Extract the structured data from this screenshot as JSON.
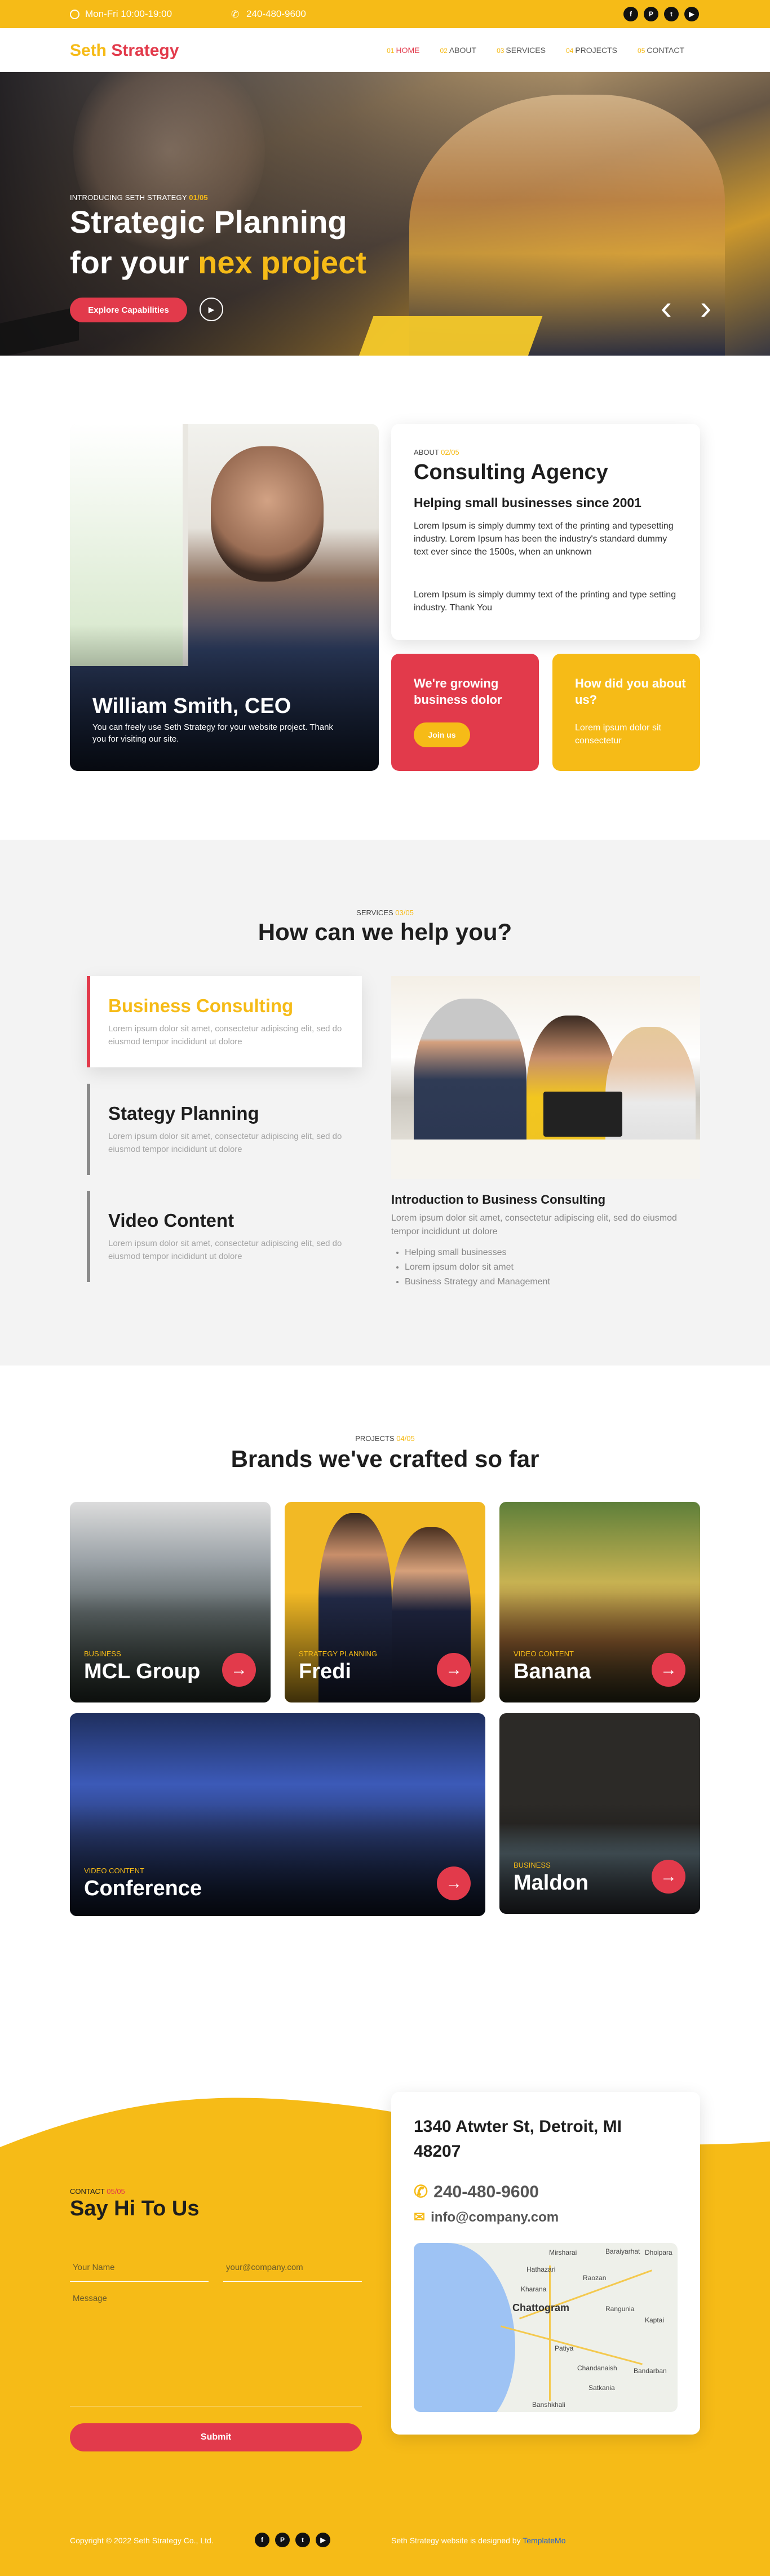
{
  "topbar": {
    "hours": "Mon-Fri 10:00-19:00",
    "phone": "240-480-9600",
    "social": [
      "facebook-icon",
      "pinterest-icon",
      "twitter-icon",
      "youtube-icon"
    ]
  },
  "nav": {
    "logo_a": "Seth",
    "logo_b": " Strategy",
    "items": [
      {
        "num": "01",
        "label": "HOME"
      },
      {
        "num": "02",
        "label": "ABOUT"
      },
      {
        "num": "03",
        "label": "SERVICES"
      },
      {
        "num": "04",
        "label": "PROJECTS"
      },
      {
        "num": "05",
        "label": "CONTACT"
      }
    ]
  },
  "hero": {
    "eyebrow": "INTRODUCING SETH STRATEGY ",
    "eyebrow_count": "01/05",
    "line1": "Strategic Planning",
    "line2_a": "for your ",
    "line2_b": "nex project",
    "cta": "Explore Capabilities",
    "play": "▶",
    "prev": "‹",
    "next": "›"
  },
  "about": {
    "ceo_name": "William Smith, CEO",
    "ceo_text": "You can freely use Seth Strategy for your website project. Thank you for visiting our site.",
    "eyebrow": "ABOUT ",
    "eyebrow_count": "02/05",
    "title": "Consulting Agency",
    "subtitle": "Helping small businesses since 2001",
    "para1": "Lorem Ipsum is simply dummy text of the printing and typesetting industry. Lorem Ipsum has been the industry's standard dummy text ever since the 1500s, when an unknown",
    "para2": "Lorem Ipsum is simply dummy text of the printing and type setting industry. Thank You",
    "card_red_title": "We're growing business dolor",
    "card_red_button": "Join us",
    "card_yellow_title": "How did you about us?",
    "card_yellow_text": "Lorem ipsum dolor sit consectetur"
  },
  "services": {
    "eyebrow": "SERVICES ",
    "eyebrow_count": "03/05",
    "title": "How can we help you?",
    "tabs": [
      {
        "title": "Business Consulting",
        "text": "Lorem ipsum dolor sit amet, consectetur adipiscing elit, sed do eiusmod tempor incididunt ut dolore"
      },
      {
        "title": "Stategy Planning",
        "text": "Lorem ipsum dolor sit amet, consectetur adipiscing elit, sed do eiusmod tempor incididunt ut dolore"
      },
      {
        "title": "Video Content",
        "text": "Lorem ipsum dolor sit amet, consectetur adipiscing elit, sed do eiusmod tempor incididunt ut dolore"
      }
    ],
    "detail_title": "Introduction to Business Consulting",
    "detail_text": "Lorem ipsum dolor sit amet, consectetur adipiscing elit, sed do eiusmod tempor incididunt ut dolore",
    "detail_list": [
      "Helping small businesses",
      "Lorem ipsum dolor sit amet",
      "Business Strategy and Management"
    ]
  },
  "projects": {
    "eyebrow": "PROJECTS ",
    "eyebrow_count": "04/05",
    "title": "Brands we've crafted so far",
    "items": [
      {
        "category": "BUSINESS",
        "title": "MCL Group"
      },
      {
        "category": "STRATEGY PLANNING",
        "title": "Fredi"
      },
      {
        "category": "VIDEO CONTENT",
        "title": "Banana"
      },
      {
        "category": "VIDEO CONTENT",
        "title": "Conference"
      },
      {
        "category": "BUSINESS",
        "title": "Maldon"
      }
    ],
    "arrow": "→"
  },
  "contact": {
    "eyebrow": "CONTACT ",
    "eyebrow_count": "05/05",
    "title": "Say Hi To Us",
    "name_placeholder": "Your Name",
    "email_placeholder": "your@company.com",
    "message_placeholder": "Message",
    "submit": "Submit",
    "address": "1340 Atwter St, Detroit, MI 48207",
    "phone": "240-480-9600",
    "email": "info@company.com",
    "map_labels": [
      "Chattogram",
      "Hathazari",
      "Raozan",
      "Patiya",
      "Satkania",
      "Banshkhali",
      "Chandanaish",
      "Dhoipara",
      "Baraiyarhat",
      "Mirsharai",
      "Kharana",
      "Rangunia",
      "Kaptai",
      "Bandarban"
    ],
    "colors": {
      "accent_yellow": "#f6bb17",
      "accent_red": "#e23a4b"
    }
  },
  "footer": {
    "copyright": "Copyright © 2022 Seth Strategy Co., Ltd.",
    "credit": "Seth Strategy website is designed by ",
    "credit_link": "TemplateMo"
  }
}
